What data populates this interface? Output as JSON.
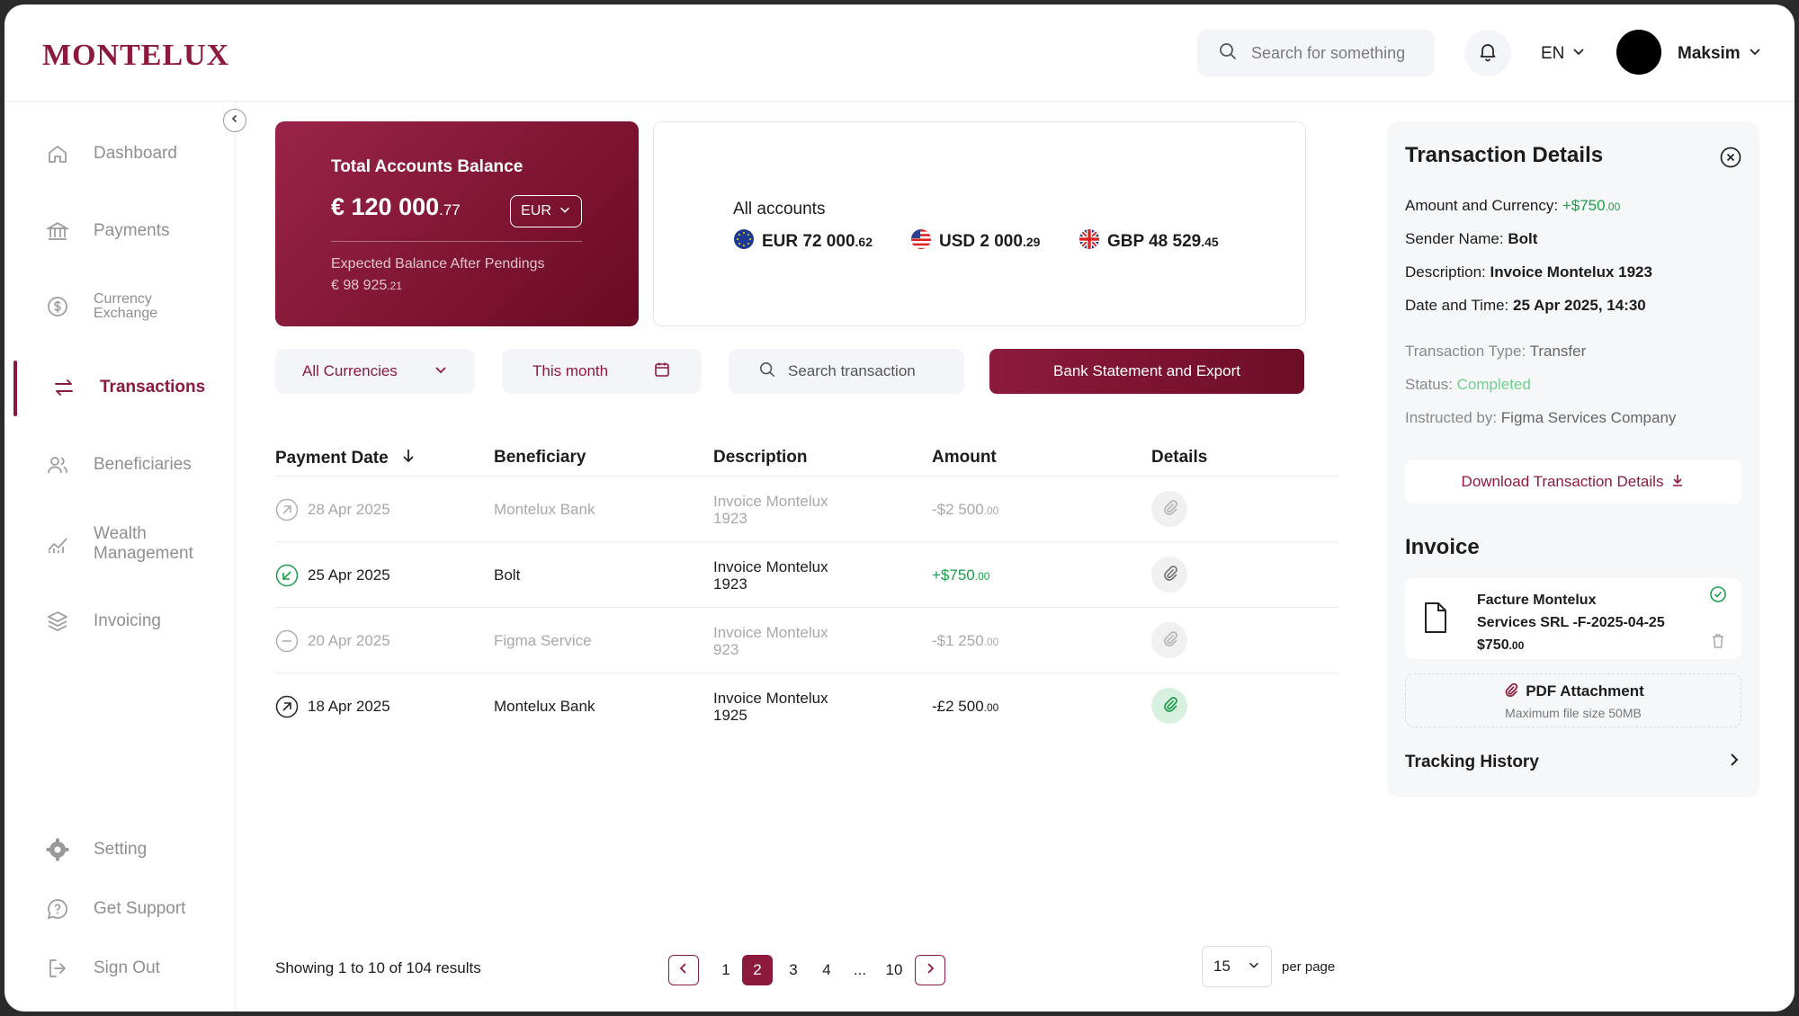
{
  "header": {
    "logo": "MONTELUX",
    "search_placeholder": "Search for something",
    "language": "EN",
    "user_name": "Maksim"
  },
  "sidebar": {
    "items": [
      {
        "label": "Dashboard",
        "icon": "home-icon"
      },
      {
        "label": "Payments",
        "icon": "bank-icon"
      },
      {
        "label": "Currency\nExchange",
        "icon": "dollar-circle-icon"
      },
      {
        "label": "Transactions",
        "icon": "transfer-arrows-icon",
        "active": true
      },
      {
        "label": "Beneficiaries",
        "icon": "users-icon"
      },
      {
        "label": "Wealth\nManagement",
        "icon": "chart-icon"
      },
      {
        "label": "Invoicing",
        "icon": "layers-icon"
      }
    ],
    "bottom_items": [
      {
        "label": "Setting",
        "icon": "gear-icon"
      },
      {
        "label": "Get Support",
        "icon": "chat-icon"
      },
      {
        "label": "Sign Out",
        "icon": "logout-icon"
      }
    ]
  },
  "balance_card": {
    "title": "Total Accounts Balance",
    "amount_main": "€ 120 000",
    "amount_cents": ".77",
    "currency": "EUR",
    "expected_label": "Expected Balance After Pendings",
    "expected_main": "€ 98 925",
    "expected_cents": ".21"
  },
  "accounts": {
    "title": "All accounts",
    "items": [
      {
        "code": "EUR 72 000",
        "cents": ".62",
        "flag": "eu-flag-icon"
      },
      {
        "code": "USD 2 000",
        "cents": ".29",
        "flag": "us-flag-icon"
      },
      {
        "code": "GBP 48 529",
        "cents": ".45",
        "flag": "uk-flag-icon"
      }
    ]
  },
  "filters": {
    "currencies": "All Currencies",
    "period": "This month",
    "search_placeholder": "Search transaction",
    "export_button": "Bank Statement and Export"
  },
  "table": {
    "columns": [
      "Payment Date",
      "Beneficiary",
      "Description",
      "Amount",
      "Details"
    ],
    "rows": [
      {
        "date": "28 Apr 2025",
        "beneficiary": "Montelux Bank",
        "desc1": "Invoice Montelux",
        "desc2": "1923",
        "amount": "-$2 500",
        "cents": ".00",
        "state": "muted",
        "icon": "arrow-up-right-icon"
      },
      {
        "date": "25 Apr 2025",
        "beneficiary": "Bolt",
        "desc1": "Invoice Montelux",
        "desc2": "1923",
        "amount": "+$750",
        "cents": ".00",
        "state": "income",
        "icon": "arrow-down-left-icon"
      },
      {
        "date": "20 Apr 2025",
        "beneficiary": "Figma Service",
        "desc1": "Invoice Montelux",
        "desc2": "923",
        "amount": "-$1 250",
        "cents": ".00",
        "state": "muted",
        "icon": "minus-circle-icon"
      },
      {
        "date": "18 Apr 2025",
        "beneficiary": "Montelux Bank",
        "desc1": "Invoice Montelux",
        "desc2": "1925",
        "amount": "-£2 500",
        "cents": ".00",
        "state": "normal",
        "icon": "arrow-up-right-icon"
      }
    ]
  },
  "pagination": {
    "summary": "Showing 1 to 10 of 104 results",
    "pages": [
      "1",
      "2",
      "3",
      "4",
      "...",
      "10"
    ],
    "current": "2",
    "per_page_value": "15",
    "per_page_label": "per page"
  },
  "details": {
    "title": "Transaction Details",
    "amount_label": "Amount  and Currency:",
    "amount_value": "+$750",
    "amount_cents": ".00",
    "sender_label": "Sender Name:",
    "sender_value": "Bolt",
    "description_label": "Description:",
    "description_value": "Invoice Montelux 1923",
    "datetime_label": "Date and Time:",
    "datetime_value": "25 Apr 2025, 14:30",
    "type_label": "Transaction Type:",
    "type_value": "Transfer",
    "status_label": "Status:",
    "status_value": "Completed",
    "instructed_label": "Instructed by:",
    "instructed_value": "Figma Services Company",
    "download_button": "Download Transaction Details",
    "invoice_title": "Invoice",
    "invoice_line1": "Facture Montelux",
    "invoice_line2": "Services SRL -F-2025-04-25",
    "invoice_amount": "$750",
    "invoice_cents": ".00",
    "pdf_label": "PDF Attachment",
    "pdf_hint": "Maximum file size 50MB",
    "tracking": "Tracking History"
  },
  "colors": {
    "brand": "#8c1a3c",
    "income": "#1a9e4a",
    "muted": "#a8a8a8"
  }
}
